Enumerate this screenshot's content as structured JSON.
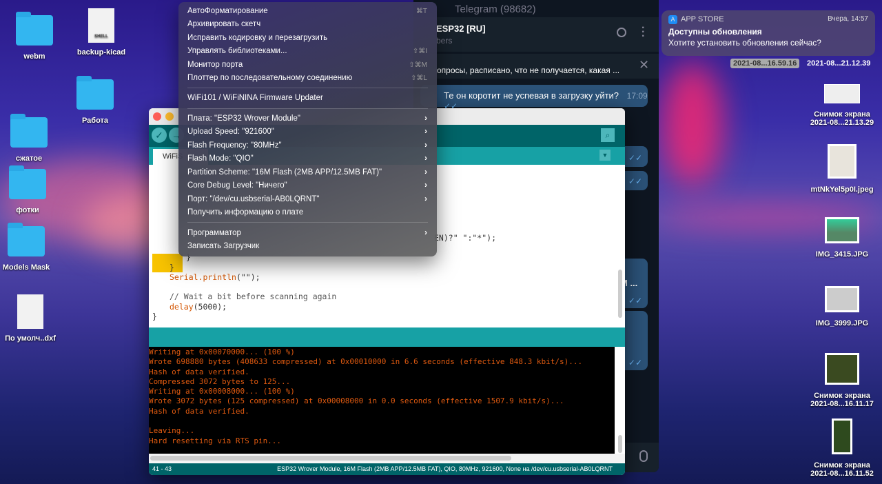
{
  "desktop": {
    "left_icons": [
      {
        "label": "webm",
        "type": "folder"
      },
      {
        "label": "backup-kicad",
        "type": "doc",
        "badge": "SHELL"
      },
      {
        "label": "Работа",
        "type": "folder"
      },
      {
        "label": "сжатое",
        "type": "folder"
      },
      {
        "label": "фотки",
        "type": "folder"
      },
      {
        "label": "Models Mask",
        "type": "folder"
      },
      {
        "label": "По умолч..dxf",
        "type": "doc"
      }
    ],
    "right_icons": [
      {
        "label": "2021-08...16.59.16"
      },
      {
        "label": "2021-08...21.12.39"
      },
      {
        "label1": "Снимок экрана",
        "label2": "2021-08...21.13.29"
      },
      {
        "label1": "mtNkYel5p0I.jpeg"
      },
      {
        "label1": "IMG_3415.JPG"
      },
      {
        "label1": "IMG_3999.JPG"
      },
      {
        "label1": "Снимок экрана",
        "label2": "2021-08...16.11.17"
      },
      {
        "label1": "Снимок экрана",
        "label2": "2021-08...16.11.52"
      }
    ]
  },
  "notification": {
    "app": "APP STORE",
    "time": "Вчера, 14:57",
    "title": "Доступны обновления",
    "body": "Хотите установить обновления сейчас?"
  },
  "telegram": {
    "title": "Telegram (98682)",
    "chat": "ESP32 [RU]",
    "subtitle": "bers",
    "pinned": "опросы, расписано, что не получается, какая ...",
    "message": "Те он коротит не успевая в загрузку уйти?",
    "message_time": "17:09",
    "msg2_text": "М ...",
    "ticks": "✓✓"
  },
  "menu": {
    "items": [
      {
        "label": "АвтоФорматирование",
        "shortcut": "⌘T"
      },
      {
        "label": "Архивировать скетч"
      },
      {
        "label": "Исправить кодировку и перезагрузить"
      },
      {
        "label": "Управлять библиотеками...",
        "shortcut": "⇧⌘I"
      },
      {
        "label": "Монитор порта",
        "shortcut": "⇧⌘M"
      },
      {
        "label": "Плоттер по последовательному соединению",
        "shortcut": "⇧⌘L"
      },
      {
        "label": "WiFi101 / WiFiNINA Firmware Updater"
      },
      {
        "label": "Плата: \"ESP32 Wrover Module\""
      },
      {
        "label": "Upload Speed: \"921600\""
      },
      {
        "label": "Flash Frequency: \"80MHz\""
      },
      {
        "label": "Flash Mode: \"QIO\""
      },
      {
        "label": "Partition Scheme: \"16M Flash (2MB APP/12.5MB FAT)\""
      },
      {
        "label": "Core Debug Level: \"Ничего\""
      },
      {
        "label": "Порт: \"/dev/cu.usbserial-AB0LQRNT\""
      },
      {
        "label": "Получить информацию о плате"
      },
      {
        "label": "Программатор"
      },
      {
        "label": "Записать Загрузчик"
      }
    ]
  },
  "arduino": {
    "tab": "WiFiS",
    "code": {
      "l1": "EN)?\" \":\"*\");",
      "l2": "}",
      "l3": "}",
      "l4_fn": "Serial.println",
      "l4_rest": "(\"\");",
      "l5": "// Wait a bit before scanning again",
      "l6_fn": "delay",
      "l6_rest": "(5000);",
      "l7": "}"
    },
    "console": [
      "Writing at 0x00070000... (100 %)",
      "Wrote 698880 bytes (408633 compressed) at 0x00010000 in 6.6 seconds (effective 848.3 kbit/s)...",
      "Hash of data verified.",
      "Compressed 3072 bytes to 125...",
      "Writing at 0x00008000... (100 %)",
      "Wrote 3072 bytes (125 compressed) at 0x00008000 in 0.0 seconds (effective 1507.9 kbit/s)...",
      "Hash of data verified.",
      "",
      "Leaving...",
      "Hard resetting via RTS pin..."
    ],
    "line_range": "41 - 43",
    "board_status": "ESP32 Wrover Module, 16M Flash (2MB APP/12.5MB FAT), QIO, 80MHz, 921600, None на /dev/cu.usbserial-AB0LQRNT"
  }
}
